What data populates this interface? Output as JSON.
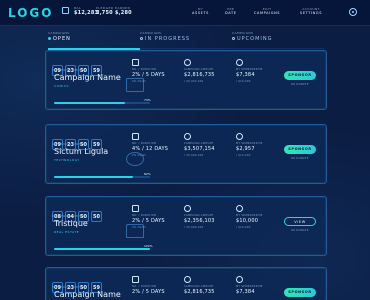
{
  "app": {
    "logo": "LOGO"
  },
  "header": {
    "stats": [
      {
        "label": "BAL",
        "value": "$12,283"
      },
      {
        "label": "PLEDGED",
        "value": "3,750"
      },
      {
        "label": "EARNED",
        "value": "$,280"
      }
    ],
    "links": [
      {
        "label": "MY",
        "value": "ASSETS"
      },
      {
        "label": "PRE",
        "value": "DATE"
      },
      {
        "label": "EDIT",
        "value": "CAMPAIGNS"
      },
      {
        "label": "ACCOUNT",
        "value": "SETTINGS"
      }
    ]
  },
  "tabs": [
    {
      "small": "CAMPAIGNS",
      "name": "OPEN",
      "active": true
    },
    {
      "small": "CAMPAIGNS",
      "name": "IN PROGRESS",
      "active": false
    },
    {
      "small": "CAMPAIGNS",
      "name": "UPCOMING",
      "active": false
    }
  ],
  "cards": [
    {
      "countdown": [
        "09",
        "23",
        "50",
        "59"
      ],
      "countdown_label": "DAYS HOURS MIN SEC",
      "name": "Campaign Name",
      "category": "COMICS",
      "progress_pct": 74,
      "progress_label": "74%",
      "metrics": [
        {
          "label": "NO. / DURATION",
          "value": "2% / 5 DAYS",
          "sub": "2% DAILY"
        },
        {
          "label": "CAMPAIGN AMOUNT",
          "value": "$2,816,735",
          "sub": "/ $5,000,000"
        },
        {
          "label": "MY SPONSORSHIP",
          "value": "$7,384",
          "sub": "/ $10,000"
        }
      ],
      "button": "SPONSOR",
      "button_sub": "OR DONATE"
    },
    {
      "countdown": [
        "09",
        "23",
        "50",
        "59"
      ],
      "countdown_label": "DAYS HOURS MIN SEC",
      "name": "Sictum Ligula",
      "category": "TECHNOLOGY",
      "progress_pct": 82,
      "progress_label": "82%",
      "metrics": [
        {
          "label": "NO. / DURATION",
          "value": "4% / 12 DAYS",
          "sub": "2% DAILY"
        },
        {
          "label": "CAMPAIGN AMOUNT",
          "value": "$3,507,154",
          "sub": "/ $5,000,000"
        },
        {
          "label": "MY SPONSORSHIP",
          "value": "$2,957",
          "sub": "/ $10,000"
        }
      ],
      "button": "SPONSOR",
      "button_sub": "OR DONATE"
    },
    {
      "countdown": [
        "08",
        "04",
        "50",
        "50"
      ],
      "countdown_label": "DAYS HOURS MIN SEC",
      "name": "Tristique",
      "category": "REAL ESTATE",
      "progress_pct": 100,
      "progress_label": "102%",
      "metrics": [
        {
          "label": "NO. / DURATION",
          "value": "2% / 5 DAYS",
          "sub": "2% DAILY"
        },
        {
          "label": "CAMPAIGN AMOUNT",
          "value": "$2,356,103",
          "sub": "/ $5,000,000"
        },
        {
          "label": "MY SPONSORSHIP",
          "value": "$10,000",
          "sub": "/ $10,000"
        }
      ],
      "button": "VIEW",
      "button_sub": "OR DONATE",
      "button_style": "outline"
    },
    {
      "countdown": [
        "09",
        "23",
        "50",
        "59"
      ],
      "countdown_label": "DAYS HOURS MIN SEC",
      "name": "Campaign Name",
      "category": "",
      "progress_pct": 0,
      "progress_label": "",
      "metrics": [
        {
          "label": "NO. / DURATION",
          "value": "2% / 5 DAYS",
          "sub": ""
        },
        {
          "label": "CAMPAIGN AMOUNT",
          "value": "$2,816,735",
          "sub": ""
        },
        {
          "label": "MY SPONSORSHIP",
          "value": "$7,384",
          "sub": ""
        }
      ],
      "button": "SPONSOR",
      "button_sub": ""
    }
  ]
}
